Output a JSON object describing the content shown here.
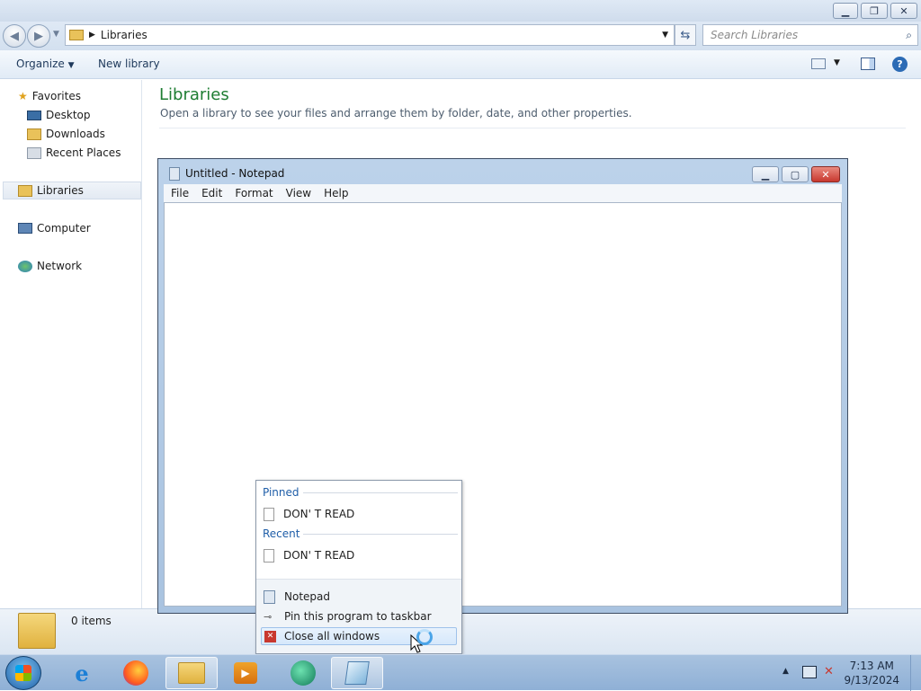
{
  "explorer": {
    "address": {
      "crumb": "Libraries"
    },
    "search": {
      "placeholder": "Search Libraries"
    },
    "toolbar": {
      "organize": "Organize",
      "new_library": "New library"
    },
    "sidebar": {
      "favorites": "Favorites",
      "desktop": "Desktop",
      "downloads": "Downloads",
      "recent_places": "Recent Places",
      "libraries": "Libraries",
      "computer": "Computer",
      "network": "Network"
    },
    "content": {
      "title": "Libraries",
      "subtitle": "Open a library to see your files and arrange them by folder, date, and other properties."
    },
    "status": {
      "items": "0 items"
    }
  },
  "notepad": {
    "title": "Untitled - Notepad",
    "menu": [
      "File",
      "Edit",
      "Format",
      "View",
      "Help"
    ]
  },
  "jumplist": {
    "pinned_header": "Pinned",
    "pinned_item": "DON' T READ",
    "recent_header": "Recent",
    "recent_item": "DON' T READ",
    "app": "Notepad",
    "pin": "Pin this program to taskbar",
    "close": "Close all windows"
  },
  "taskbar": {
    "time": "7:13 AM",
    "date": "9/13/2024"
  },
  "colors": {
    "accent_green": "#1e7d32",
    "header_blue": "#1f5ea8",
    "close_red": "#c8382f"
  }
}
